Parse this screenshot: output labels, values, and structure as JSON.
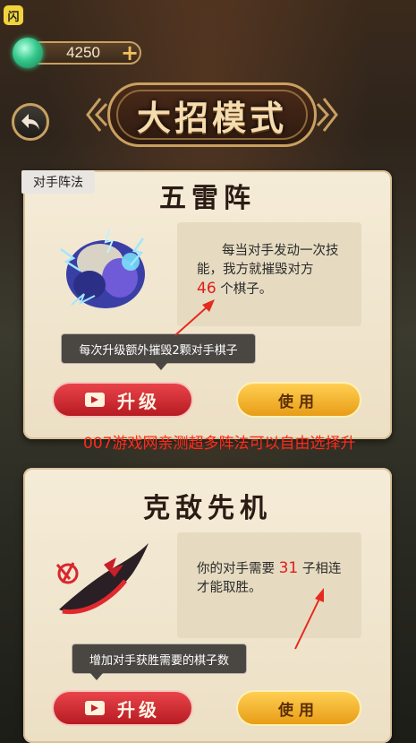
{
  "app_badge": "闪",
  "currency": {
    "amount": "4250",
    "plus": "+"
  },
  "page_title": "大招模式",
  "tab_label": "对手阵法",
  "cards": [
    {
      "title": "五雷阵",
      "desc_before": "每当对手发动一次技能，我方就摧毁对方",
      "desc_number": "46",
      "desc_after": "个棋子。",
      "tooltip": "每次升级额外摧毁2颗对手棋子",
      "upgrade_label": "升级",
      "use_label": "使用"
    },
    {
      "title": "克敌先机",
      "desc_before": "你的对手需要",
      "desc_number": "31",
      "desc_after": "子相连才能取胜。",
      "tooltip": "增加对手获胜需要的棋子数",
      "upgrade_label": "升级",
      "use_label": "使用"
    }
  ],
  "watermark": "007游戏网亲测超多阵法可以自由选择升",
  "colors": {
    "highlight_number": "#e11b1b",
    "upgrade_button": "#d02a30",
    "use_button": "#f4b42e",
    "card_bg": "#f2e8d2"
  },
  "icons": [
    "jade-currency-icon",
    "plus-icon",
    "back-arrow-icon",
    "video-icon",
    "thunder-beast-art",
    "dragon-blade-art"
  ]
}
